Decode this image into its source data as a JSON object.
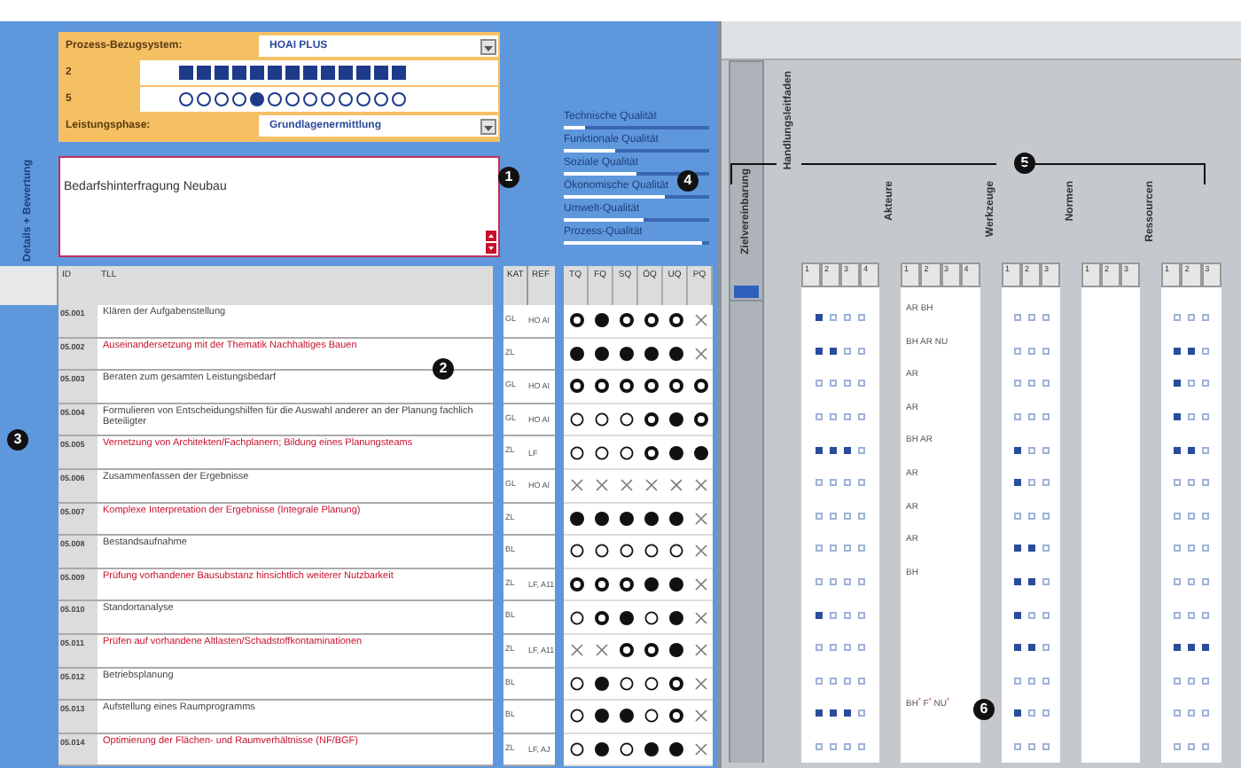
{
  "sidebar_label": "Details + Bewertung",
  "process": {
    "label": "Prozess-Bezugsystem:",
    "value": "HOAI PLUS"
  },
  "scales": [
    {
      "label": "2",
      "kind": "squares",
      "cells": [
        true,
        true,
        true,
        true,
        true,
        true,
        true,
        true,
        true,
        true,
        true,
        true,
        true
      ]
    },
    {
      "label": "5",
      "kind": "circles",
      "cells": [
        false,
        false,
        false,
        false,
        true,
        false,
        false,
        false,
        false,
        false,
        false,
        false,
        false
      ]
    }
  ],
  "phase": {
    "label": "Leistungsphase:",
    "value": "Grundlagenermittlung"
  },
  "note": "Bedarfshinterfragung Neubau",
  "qualities": [
    {
      "label": "Technische Qualität",
      "level": 0.15
    },
    {
      "label": "Funktionale Qualität",
      "level": 0.35
    },
    {
      "label": "Soziale Qualität",
      "level": 0.5
    },
    {
      "label": "Ökonomische Qualität",
      "level": 0.7
    },
    {
      "label": "Umwelt-Qualität",
      "level": 0.55
    },
    {
      "label": "Prozess-Qualität",
      "level": 0.95
    }
  ],
  "columns": [
    "ID",
    "TLL",
    "KAT",
    "REF",
    "TQ",
    "FQ",
    "SQ",
    "ÖQ",
    "UQ",
    "PQ"
  ],
  "right_columns": [
    {
      "label": "Zielvereinbarung"
    },
    {
      "label": "Handlungsleitfaden",
      "numbers": [
        "1",
        "2",
        "3",
        "4"
      ]
    },
    {
      "label": "Akteure",
      "numbers": [
        "1",
        "2",
        "3",
        "4"
      ]
    },
    {
      "label": "Werkzeuge",
      "numbers": [
        "1",
        "2",
        "3"
      ]
    },
    {
      "label": "Normen",
      "numbers": [
        "1",
        "2",
        "3"
      ]
    },
    {
      "label": "Ressourcen",
      "numbers": [
        "1",
        "2",
        "3"
      ]
    }
  ],
  "rows": [
    {
      "id": "05.001",
      "tll": "Klären der Aufgabenstellung",
      "highlight": false,
      "kat": "GL",
      "ref": "HO AI",
      "ratings": [
        {
          "kind": "bold"
        },
        {
          "kind": "filled"
        },
        {
          "kind": "bold"
        },
        {
          "kind": "bold"
        },
        {
          "kind": "bold"
        },
        {
          "kind": "none"
        }
      ],
      "handlung": [
        true,
        false,
        false,
        false
      ],
      "akteure": "AR BH",
      "werkzeuge": [
        false,
        false,
        false
      ],
      "ressourcen": [
        false,
        false,
        false
      ]
    },
    {
      "id": "05.002",
      "tll": "Auseinandersetzung mit der Thematik Nachhaltiges Bauen",
      "highlight": true,
      "kat": "ZL",
      "ratings": [
        {
          "kind": "filled"
        },
        {
          "kind": "filled"
        },
        {
          "kind": "filled"
        },
        {
          "kind": "filled"
        },
        {
          "kind": "filled"
        },
        {
          "kind": "none"
        }
      ],
      "handlung": [
        true,
        true,
        false,
        false
      ],
      "akteure": "BH AR NU",
      "werkzeuge": [
        false,
        false,
        false
      ],
      "ressourcen": [
        true,
        true,
        false
      ]
    },
    {
      "id": "05.003",
      "tll": "Beraten zum gesamten Leistungsbedarf",
      "highlight": false,
      "kat": "GL",
      "ref": "HO AI",
      "ratings": [
        {
          "kind": "bold"
        },
        {
          "kind": "bold"
        },
        {
          "kind": "bold"
        },
        {
          "kind": "bold"
        },
        {
          "kind": "bold"
        },
        {
          "kind": "bold"
        }
      ],
      "handlung": [
        false,
        false,
        false,
        false
      ],
      "akteure": "AR",
      "werkzeuge": [
        false,
        false,
        false
      ],
      "ressourcen": [
        true,
        false,
        false
      ]
    },
    {
      "id": "05.004",
      "tll": "Formulieren von Entscheidungshilfen für die Auswahl anderer an der Planung fachlich Beteiligter",
      "highlight": false,
      "kat": "GL",
      "ref": "HO AI",
      "ratings": [
        {
          "kind": "open"
        },
        {
          "kind": "open"
        },
        {
          "kind": "open"
        },
        {
          "kind": "bold"
        },
        {
          "kind": "filled"
        },
        {
          "kind": "bold"
        }
      ],
      "handlung": [
        false,
        false,
        false,
        false
      ],
      "akteure": "AR",
      "werkzeuge": [
        false,
        false,
        false
      ],
      "ressourcen": [
        true,
        false,
        false
      ]
    },
    {
      "id": "05.005",
      "tll": "Vernetzung von Architekten/Fachplanern; Bildung eines Planungsteams",
      "highlight": true,
      "kat": "ZL",
      "ref": "LF",
      "ratings": [
        {
          "kind": "open"
        },
        {
          "kind": "open"
        },
        {
          "kind": "open"
        },
        {
          "kind": "bold"
        },
        {
          "kind": "filled"
        },
        {
          "kind": "filled"
        }
      ],
      "handlung": [
        true,
        true,
        true,
        false
      ],
      "akteure": "BH AR",
      "werkzeuge": [
        true,
        false,
        false
      ],
      "ressourcen": [
        true,
        true,
        false
      ]
    },
    {
      "id": "05.006",
      "tll": "Zusammenfassen der Ergebnisse",
      "highlight": false,
      "kat": "GL",
      "ref": "HO AI",
      "ratings": [
        {
          "kind": "none"
        },
        {
          "kind": "none"
        },
        {
          "kind": "none"
        },
        {
          "kind": "none"
        },
        {
          "kind": "none"
        },
        {
          "kind": "none"
        }
      ],
      "handlung": [
        false,
        false,
        false,
        false
      ],
      "akteure": "AR",
      "werkzeuge": [
        true,
        false,
        false
      ],
      "ressourcen": [
        false,
        false,
        false
      ]
    },
    {
      "id": "05.007",
      "tll": "Komplexe Interpretation der Ergebnisse (Integrale Planung)",
      "highlight": true,
      "kat": "ZL",
      "ratings": [
        {
          "kind": "filled"
        },
        {
          "kind": "filled"
        },
        {
          "kind": "filled"
        },
        {
          "kind": "filled"
        },
        {
          "kind": "filled"
        },
        {
          "kind": "none"
        }
      ],
      "handlung": [
        false,
        false,
        false,
        false
      ],
      "akteure": "AR",
      "werkzeuge": [
        false,
        false,
        false
      ],
      "ressourcen": [
        false,
        false,
        false
      ]
    },
    {
      "id": "05.008",
      "tll": "Bestandsaufnahme",
      "highlight": false,
      "kat": "BL",
      "ratings": [
        {
          "kind": "open"
        },
        {
          "kind": "open"
        },
        {
          "kind": "open"
        },
        {
          "kind": "open"
        },
        {
          "kind": "open"
        },
        {
          "kind": "none"
        }
      ],
      "handlung": [
        false,
        false,
        false,
        false
      ],
      "akteure": "AR",
      "werkzeuge": [
        true,
        true,
        false
      ],
      "ressourcen": [
        false,
        false,
        false
      ]
    },
    {
      "id": "05.009",
      "tll": "Prüfung vorhandener Bausubstanz hinsichtlich weiterer Nutzbarkeit",
      "highlight": true,
      "kat": "ZL",
      "ref": "LF, A11",
      "ratings": [
        {
          "kind": "bold"
        },
        {
          "kind": "bold"
        },
        {
          "kind": "bold"
        },
        {
          "kind": "filled"
        },
        {
          "kind": "filled"
        },
        {
          "kind": "none"
        }
      ],
      "handlung": [
        false,
        false,
        false,
        false
      ],
      "akteure": "BH",
      "werkzeuge": [
        true,
        true,
        false
      ],
      "ressourcen": [
        false,
        false,
        false
      ]
    },
    {
      "id": "05.010",
      "tll": "Standortanalyse",
      "highlight": false,
      "kat": "BL",
      "ratings": [
        {
          "kind": "open"
        },
        {
          "kind": "bold"
        },
        {
          "kind": "filled"
        },
        {
          "kind": "open"
        },
        {
          "kind": "filled"
        },
        {
          "kind": "none"
        }
      ],
      "handlung": [
        true,
        false,
        false,
        false
      ],
      "werkzeuge": [
        true,
        false,
        false
      ],
      "ressourcen": [
        false,
        false,
        false
      ]
    },
    {
      "id": "05.011",
      "tll": "Prüfen auf vorhandene Altlasten/Schadstoffkontaminationen",
      "highlight": true,
      "kat": "ZL",
      "ref": "LF, A11",
      "ratings": [
        {
          "kind": "none"
        },
        {
          "kind": "none"
        },
        {
          "kind": "bold"
        },
        {
          "kind": "bold"
        },
        {
          "kind": "filled"
        },
        {
          "kind": "none"
        }
      ],
      "handlung": [
        false,
        false,
        false,
        false
      ],
      "werkzeuge": [
        true,
        true,
        false
      ],
      "ressourcen": [
        true,
        true,
        true
      ]
    },
    {
      "id": "05.012",
      "tll": "Betriebsplanung",
      "highlight": false,
      "kat": "BL",
      "ratings": [
        {
          "kind": "open"
        },
        {
          "kind": "filled"
        },
        {
          "kind": "open"
        },
        {
          "kind": "open"
        },
        {
          "kind": "bold"
        },
        {
          "kind": "none"
        }
      ],
      "handlung": [
        false,
        false,
        false,
        false
      ],
      "werkzeuge": [
        false,
        false,
        false
      ],
      "ressourcen": [
        false,
        false,
        false
      ]
    },
    {
      "id": "05.013",
      "tll": "Aufstellung eines Raumprogramms",
      "highlight": false,
      "kat": "BL",
      "ratings": [
        {
          "kind": "open"
        },
        {
          "kind": "filled"
        },
        {
          "kind": "filled"
        },
        {
          "kind": "open"
        },
        {
          "kind": "bold"
        },
        {
          "kind": "none"
        }
      ],
      "handlung": [
        true,
        true,
        true,
        false
      ],
      "akteure": "BH$^{*}$ F$^{*}$ NU$^{*}$",
      "werkzeuge": [
        true,
        false,
        false
      ],
      "ressourcen": [
        false,
        false,
        false
      ]
    },
    {
      "id": "05.014",
      "tll": "Optimierung der Flächen- und Raumverhältnisse (NF/BGF)",
      "highlight": true,
      "kat": "ZL",
      "ref": "LF, AJ",
      "ratings": [
        {
          "kind": "open"
        },
        {
          "kind": "filled"
        },
        {
          "kind": "open"
        },
        {
          "kind": "filled"
        },
        {
          "kind": "filled"
        },
        {
          "kind": "none"
        }
      ],
      "handlung": [
        false,
        false,
        false,
        false
      ],
      "werkzeuge": [
        false,
        false,
        false
      ],
      "ressourcen": [
        false,
        false,
        false
      ]
    }
  ],
  "callouts": [
    "1",
    "2",
    "3",
    "4",
    "5",
    "6"
  ]
}
